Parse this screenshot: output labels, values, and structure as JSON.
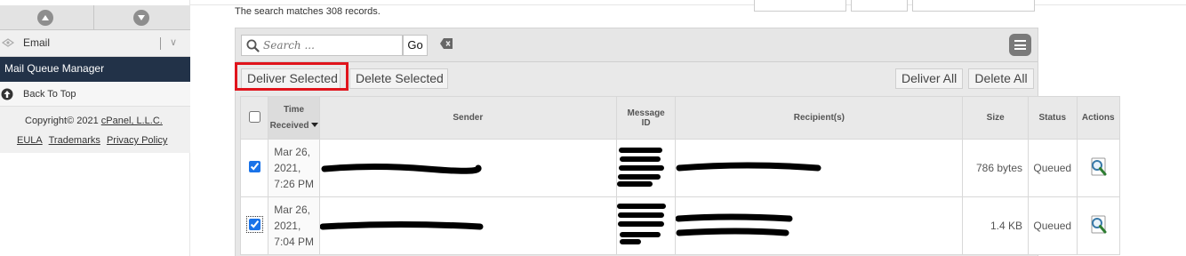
{
  "sidebar": {
    "email_label": "Email",
    "active_item": "Mail Queue Manager",
    "back_to_top": "Back To Top",
    "copyright_prefix": "Copyright© 2021 ",
    "copyright_link": "cPanel, L.L.C.",
    "footer_links": [
      "EULA",
      "Trademarks",
      "Privacy Policy"
    ]
  },
  "search_matches": "The search matches 308 records.",
  "toolbar": {
    "search_placeholder": "Search ...",
    "go_label": "Go",
    "deliver_selected": "Deliver Selected",
    "delete_selected": "Delete Selected",
    "deliver_all": "Deliver All",
    "delete_all": "Delete All"
  },
  "table": {
    "headers": {
      "time_line1": "Time",
      "time_line2": "Received",
      "sender": "Sender",
      "msgid_line1": "Message",
      "msgid_line2": "ID",
      "recipients": "Recipient(s)",
      "size": "Size",
      "status": "Status",
      "actions": "Actions"
    },
    "rows": [
      {
        "checked": true,
        "time_line1": "Mar 26,",
        "time_line2": "2021,",
        "time_line3": "7:26 PM",
        "size": "786 bytes",
        "status": "Queued"
      },
      {
        "checked": true,
        "time_line1": "Mar 26,",
        "time_line2": "2021,",
        "time_line3": "7:04 PM",
        "size": "1.4 KB",
        "status": "Queued"
      }
    ]
  },
  "colors": {
    "sidebar_active_bg": "#223248",
    "highlight_border": "#e0141c",
    "checkbox_accent": "#1a73e8"
  }
}
